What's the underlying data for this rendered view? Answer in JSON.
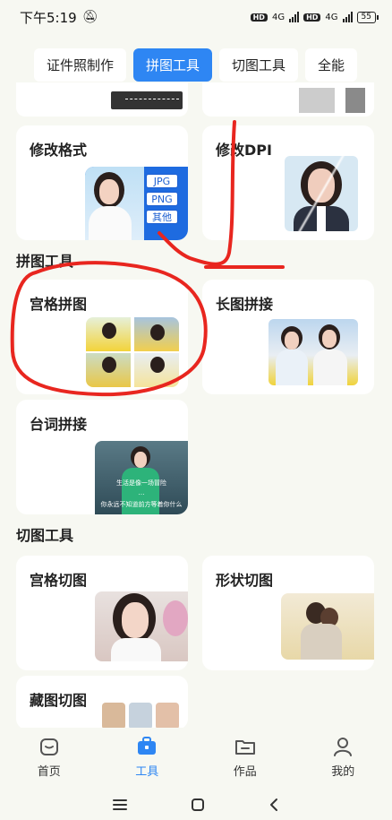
{
  "status_bar": {
    "time": "下午5:19",
    "network_1": "4G",
    "network_2": "4G",
    "hd": "HD",
    "battery": "55"
  },
  "top_tabs": [
    {
      "label": "证件照制作",
      "active": false
    },
    {
      "label": "拼图工具",
      "active": true
    },
    {
      "label": "切图工具",
      "active": false
    },
    {
      "label": "全能",
      "active": false
    }
  ],
  "format_section": {
    "cards": [
      {
        "label": "修改格式",
        "tags": [
          "JPG",
          "PNG",
          "其他"
        ]
      },
      {
        "label": "修改DPI"
      }
    ]
  },
  "collage_section": {
    "title": "拼图工具",
    "cards": [
      {
        "label": "宫格拼图"
      },
      {
        "label": "长图拼接"
      },
      {
        "label": "台词拼接",
        "caption_lines": [
          "生活是像一场冒险",
          "…",
          "你永远不知道前方等着你什么"
        ]
      }
    ]
  },
  "cut_section": {
    "title": "切图工具",
    "cards": [
      {
        "label": "宫格切图"
      },
      {
        "label": "形状切图"
      },
      {
        "label": "藏图切图"
      }
    ]
  },
  "bottom_nav": [
    {
      "label": "首页",
      "icon": "home-icon",
      "active": false
    },
    {
      "label": "工具",
      "icon": "toolbox-icon",
      "active": true
    },
    {
      "label": "作品",
      "icon": "folder-icon",
      "active": false
    },
    {
      "label": "我的",
      "icon": "profile-icon",
      "active": false
    }
  ],
  "colors": {
    "accent": "#2e86f3",
    "annotation": "#e8261f",
    "background": "#f7f8f2"
  }
}
